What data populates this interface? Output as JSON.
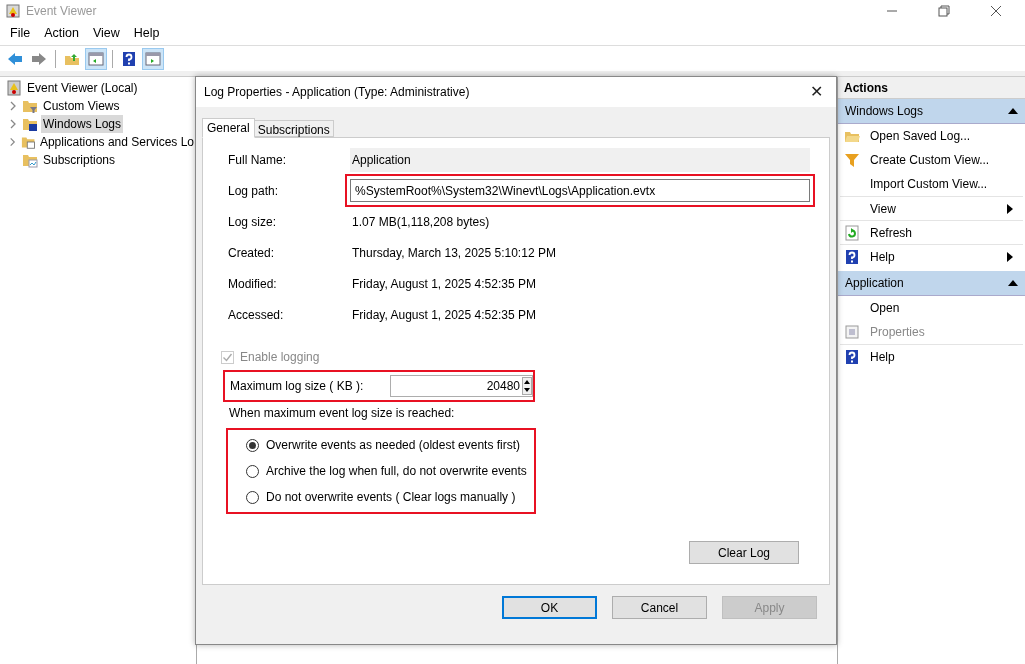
{
  "window": {
    "title": "Event Viewer"
  },
  "menu": [
    "File",
    "Action",
    "View",
    "Help"
  ],
  "toolbar": [
    {
      "pressed": false
    },
    {
      "pressed": false
    },
    {
      "pressed": false
    },
    {
      "pressed": true
    },
    {
      "pressed": false
    },
    {
      "pressed": true
    }
  ],
  "tree": [
    {
      "label": "Event Viewer (Local)",
      "expandable": false,
      "selected": false
    },
    {
      "label": "Custom Views",
      "expandable": true,
      "selected": false
    },
    {
      "label": "Windows Logs",
      "expandable": true,
      "selected": true
    },
    {
      "label": "Applications and Services Lo",
      "expandable": true,
      "selected": false
    },
    {
      "label": "Subscriptions",
      "expandable": false,
      "selected": false
    }
  ],
  "actions": {
    "title": "Actions",
    "sections": [
      {
        "title": "Windows Logs",
        "items": [
          {
            "label": "Open Saved Log...",
            "submenu": false,
            "disabled": false
          },
          {
            "label": "Create Custom View...",
            "submenu": false,
            "disabled": false
          },
          {
            "label": "Import Custom View...",
            "submenu": false,
            "disabled": false
          },
          {
            "label": "View",
            "submenu": true,
            "disabled": false
          },
          {
            "label": "Refresh",
            "submenu": false,
            "disabled": false
          },
          {
            "label": "Help",
            "submenu": true,
            "disabled": false
          }
        ]
      },
      {
        "title": "Application",
        "items": [
          {
            "label": "Open",
            "submenu": false,
            "disabled": false
          },
          {
            "label": "Properties",
            "submenu": false,
            "disabled": true
          },
          {
            "label": "Help",
            "submenu": false,
            "disabled": false
          }
        ]
      }
    ]
  },
  "dialog": {
    "title": "Log Properties - Application (Type: Administrative)",
    "close": "✕",
    "tabs": [
      {
        "label": "General",
        "selected": true
      },
      {
        "label": "Subscriptions",
        "selected": false
      }
    ],
    "fields": [
      {
        "label": "Full Name:",
        "value": "Application",
        "kind": "readonly",
        "highlighted": false
      },
      {
        "label": "Log path:",
        "value": "%SystemRoot%\\System32\\Winevt\\Logs\\Application.evtx",
        "kind": "textbox",
        "highlighted": true
      },
      {
        "label": "Log size:",
        "value": "1.07 MB(1,118,208 bytes)",
        "kind": "plain",
        "highlighted": false
      },
      {
        "label": "Created:",
        "value": "Thursday, March 13, 2025 5:10:12 PM",
        "kind": "plain",
        "highlighted": false
      },
      {
        "label": "Modified:",
        "value": "Friday, August 1, 2025 4:52:35 PM",
        "kind": "plain",
        "highlighted": false
      },
      {
        "label": "Accessed:",
        "value": "Friday, August 1, 2025 4:52:35 PM",
        "kind": "plain",
        "highlighted": false
      }
    ],
    "enable_logging": {
      "label": "Enable logging",
      "checked": true,
      "disabled": true
    },
    "max_size": {
      "label": "Maximum log size ( KB ):",
      "value": "20480",
      "highlighted": true
    },
    "policy": {
      "label": "When maximum event log size is reached:",
      "highlighted": true,
      "options": [
        {
          "label": "Overwrite events as needed (oldest events first)",
          "selected": true
        },
        {
          "label": "Archive the log when full, do not overwrite events",
          "selected": false
        },
        {
          "label": "Do not overwrite events ( Clear logs manually )",
          "selected": false
        }
      ]
    },
    "clear_button": "Clear Log",
    "buttons": [
      {
        "label": "OK",
        "default": true,
        "disabled": false
      },
      {
        "label": "Cancel",
        "default": false,
        "disabled": false
      },
      {
        "label": "Apply",
        "default": false,
        "disabled": true
      }
    ]
  }
}
